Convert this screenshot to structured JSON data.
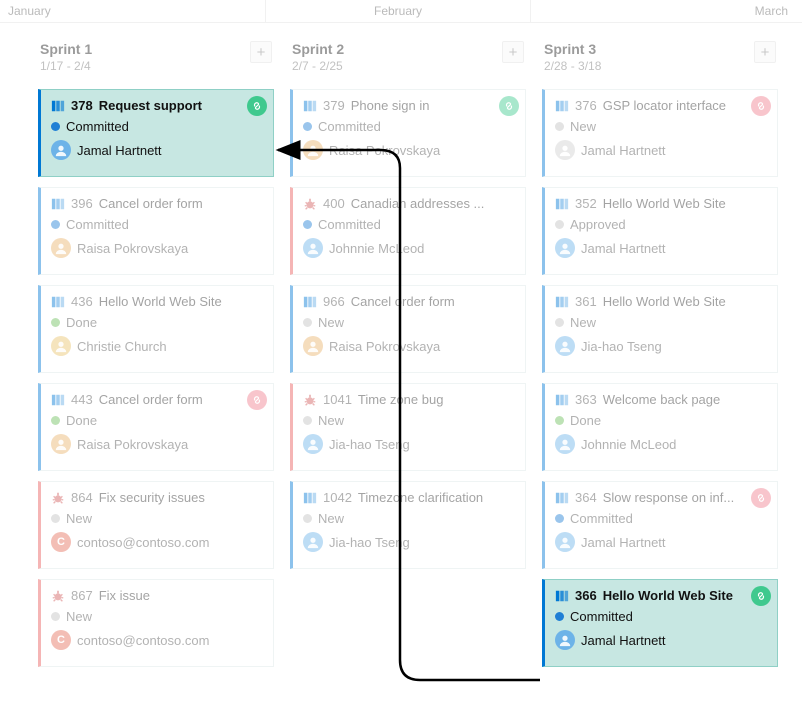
{
  "months": [
    "January",
    "February",
    "March"
  ],
  "columns": [
    {
      "title": "Sprint 1",
      "dates": "1/17 - 2/4",
      "cards": [
        {
          "type": "pbi",
          "id": "378",
          "title": "Request support",
          "state": "Committed",
          "stateColor": "#1f7fd5",
          "user": "Jamal Hartnett",
          "avatarKind": "img",
          "avatarColor": "#6db3e8",
          "link": "green",
          "border": "#0078d4",
          "highlight": true
        },
        {
          "type": "pbi",
          "id": "396",
          "title": "Cancel order form",
          "state": "Committed",
          "stateColor": "#1f7fd5",
          "user": "Raisa Pokrovskaya",
          "avatarKind": "img",
          "avatarColor": "#e8b36d",
          "link": null,
          "border": "#0078d4"
        },
        {
          "type": "pbi",
          "id": "436",
          "title": "Hello World Web Site",
          "state": "Done",
          "stateColor": "#6dbf5c",
          "user": "Christie Church",
          "avatarKind": "img",
          "avatarColor": "#e8c46d",
          "link": null,
          "border": "#0078d4"
        },
        {
          "type": "pbi",
          "id": "443",
          "title": "Cancel order form",
          "state": "Done",
          "stateColor": "#6dbf5c",
          "user": "Raisa Pokrovskaya",
          "avatarKind": "img",
          "avatarColor": "#e8b36d",
          "link": "red",
          "border": "#0078d4"
        },
        {
          "type": "bug",
          "id": "864",
          "title": "Fix security issues",
          "state": "New",
          "stateColor": "#c0c0c0",
          "user": "contoso@contoso.com",
          "avatarKind": "letter",
          "avatarLetter": "C",
          "avatarColor": "#e46f5b",
          "link": null,
          "border": "#e85c5c"
        },
        {
          "type": "bug",
          "id": "867",
          "title": "Fix issue",
          "state": "New",
          "stateColor": "#c0c0c0",
          "user": "contoso@contoso.com",
          "avatarKind": "letter",
          "avatarLetter": "C",
          "avatarColor": "#e46f5b",
          "link": null,
          "border": "#e85c5c"
        }
      ]
    },
    {
      "title": "Sprint 2",
      "dates": "2/7 - 2/25",
      "cards": [
        {
          "type": "pbi",
          "id": "379",
          "title": "Phone sign in",
          "state": "Committed",
          "stateColor": "#1f7fd5",
          "user": "Raisa Pokrovskaya",
          "avatarKind": "img",
          "avatarColor": "#e8b36d",
          "link": "green",
          "border": "#0078d4"
        },
        {
          "type": "bug",
          "id": "400",
          "title": "Canadian addresses ...",
          "state": "Committed",
          "stateColor": "#1f7fd5",
          "user": "Johnnie McLeod",
          "avatarKind": "img",
          "avatarColor": "#6db3e8",
          "link": null,
          "border": "#e85c5c"
        },
        {
          "type": "pbi",
          "id": "966",
          "title": "Cancel order form",
          "state": "New",
          "stateColor": "#c0c0c0",
          "user": "Raisa Pokrovskaya",
          "avatarKind": "img",
          "avatarColor": "#e8b36d",
          "link": null,
          "border": "#0078d4"
        },
        {
          "type": "bug",
          "id": "1041",
          "title": "Time zone bug",
          "state": "New",
          "stateColor": "#c0c0c0",
          "user": "Jia-hao Tseng",
          "avatarKind": "img",
          "avatarColor": "#6db3e8",
          "link": null,
          "border": "#e85c5c"
        },
        {
          "type": "pbi",
          "id": "1042",
          "title": "Timezone clarification",
          "state": "New",
          "stateColor": "#c0c0c0",
          "user": "Jia-hao Tseng",
          "avatarKind": "img",
          "avatarColor": "#6db3e8",
          "link": null,
          "border": "#0078d4"
        }
      ]
    },
    {
      "title": "Sprint 3",
      "dates": "2/28 - 3/18",
      "cards": [
        {
          "type": "pbi",
          "id": "376",
          "title": "GSP locator interface",
          "state": "New",
          "stateColor": "#c0c0c0",
          "user": "Jamal Hartnett",
          "avatarKind": "unassigned",
          "avatarColor": "#c8c8c8",
          "link": "red",
          "border": "#0078d4"
        },
        {
          "type": "pbi",
          "id": "352",
          "title": "Hello World Web Site",
          "state": "Approved",
          "stateColor": "#c0c0c0",
          "user": "Jamal Hartnett",
          "avatarKind": "img",
          "avatarColor": "#6db3e8",
          "link": null,
          "border": "#0078d4"
        },
        {
          "type": "pbi",
          "id": "361",
          "title": "Hello World Web Site",
          "state": "New",
          "stateColor": "#c0c0c0",
          "user": "Jia-hao Tseng",
          "avatarKind": "img",
          "avatarColor": "#6db3e8",
          "link": null,
          "border": "#0078d4"
        },
        {
          "type": "pbi",
          "id": "363",
          "title": "Welcome back page",
          "state": "Done",
          "stateColor": "#6dbf5c",
          "user": "Johnnie McLeod",
          "avatarKind": "img",
          "avatarColor": "#6db3e8",
          "link": null,
          "border": "#0078d4"
        },
        {
          "type": "pbi",
          "id": "364",
          "title": "Slow response on inf...",
          "state": "Committed",
          "stateColor": "#1f7fd5",
          "user": "Jamal Hartnett",
          "avatarKind": "img",
          "avatarColor": "#6db3e8",
          "link": "red",
          "border": "#0078d4"
        },
        {
          "type": "pbi",
          "id": "366",
          "title": "Hello World Web Site",
          "state": "Committed",
          "stateColor": "#1f7fd5",
          "user": "Jamal Hartnett",
          "avatarKind": "img",
          "avatarColor": "#6db3e8",
          "link": "green",
          "border": "#0078d4",
          "highlight": true
        }
      ]
    }
  ],
  "linkColors": {
    "green": "#3fc98e",
    "red": "#f07f8f"
  },
  "typeColors": {
    "pbi": "#0078d4",
    "bug": "#d15b5b"
  }
}
